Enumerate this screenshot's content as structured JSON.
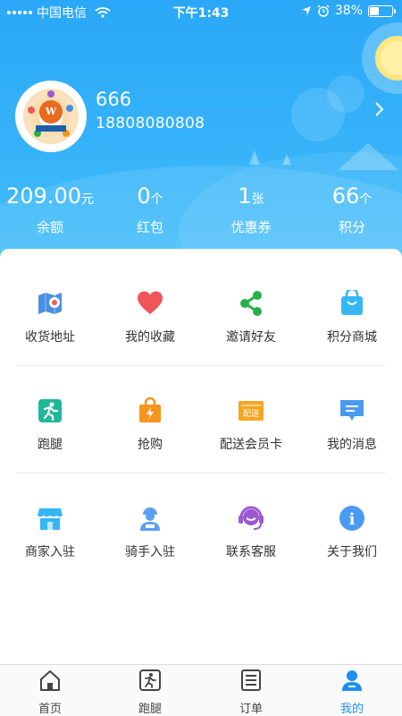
{
  "status_bar": {
    "carrier": "中国电信",
    "time": "下午1:43",
    "battery": "38%",
    "battery_level": 0.38
  },
  "profile": {
    "avatar_badge": "W",
    "name": "666",
    "phone": "18808080808"
  },
  "stats": [
    {
      "value": "209.00",
      "unit": "元",
      "label": "余额"
    },
    {
      "value": "0",
      "unit": "个",
      "label": "红包"
    },
    {
      "value": "1",
      "unit": "张",
      "label": "优惠券"
    },
    {
      "value": "66",
      "unit": "个",
      "label": "积分"
    }
  ],
  "menu": {
    "rows": [
      [
        {
          "label": "收货地址",
          "icon": "map-pin-icon",
          "color": "#4a90e2"
        },
        {
          "label": "我的收藏",
          "icon": "heart-icon",
          "color": "#f0555a"
        },
        {
          "label": "邀请好友",
          "icon": "share-icon",
          "color": "#27b04a"
        },
        {
          "label": "积分商城",
          "icon": "shopping-bag-icon",
          "color": "#36b7f4"
        }
      ],
      [
        {
          "label": "跑腿",
          "icon": "runner-icon",
          "color": "#20b89a"
        },
        {
          "label": "抢购",
          "icon": "flash-bag-icon",
          "color": "#f7941d"
        },
        {
          "label": "配送会员卡",
          "icon": "delivery-card-icon",
          "color": "#f5a623",
          "icon_text": "配送"
        },
        {
          "label": "我的消息",
          "icon": "message-icon",
          "color": "#4a9af0"
        }
      ],
      [
        {
          "label": "商家入驻",
          "icon": "store-icon",
          "color": "#36b7f4"
        },
        {
          "label": "骑手入驻",
          "icon": "rider-icon",
          "color": "#5a9ff0"
        },
        {
          "label": "联系客服",
          "icon": "headset-icon",
          "color": "#9b59d0"
        },
        {
          "label": "关于我们",
          "icon": "info-icon",
          "color": "#4a9af0",
          "icon_text": "i"
        }
      ]
    ]
  },
  "tabbar": {
    "tabs": [
      {
        "label": "首页",
        "icon": "home-icon",
        "active": false
      },
      {
        "label": "跑腿",
        "icon": "errand-icon",
        "active": false
      },
      {
        "label": "订单",
        "icon": "order-list-icon",
        "active": false
      },
      {
        "label": "我的",
        "icon": "profile-icon",
        "active": true
      }
    ],
    "active_color": "#1e8ff0",
    "inactive_color": "#444444"
  },
  "colors": {
    "header_gradient_top": "#2aa8f7",
    "header_gradient_bottom": "#47c0fb"
  }
}
